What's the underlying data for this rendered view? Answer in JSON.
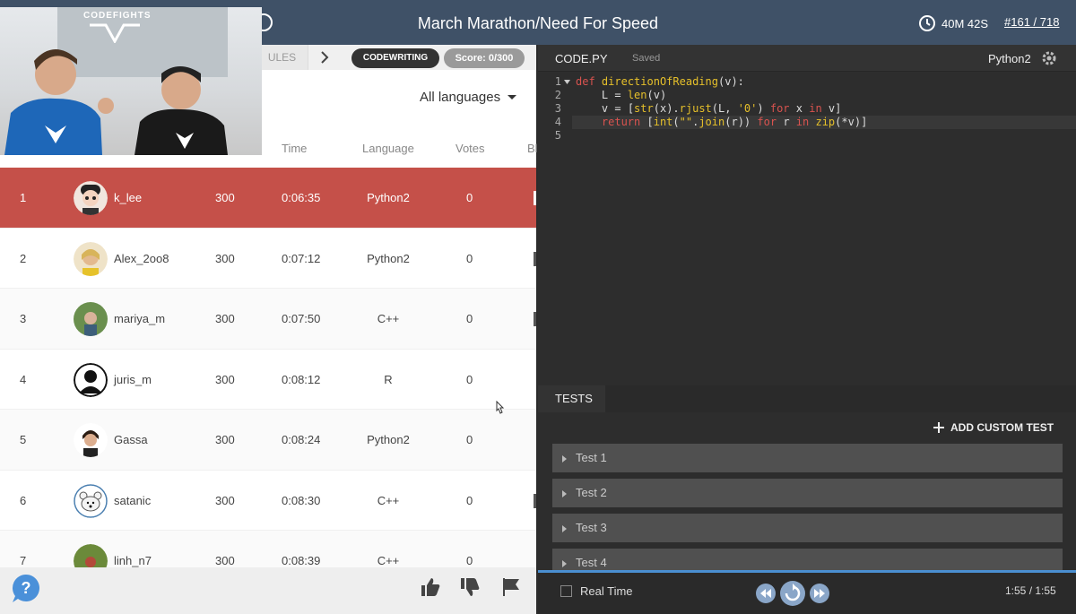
{
  "header": {
    "title": "March Marathon/Need For Speed",
    "timer": "40M 42S",
    "rank": "#161 / 718"
  },
  "left": {
    "tabs": {
      "rules": "ULES",
      "codewriting": "CODEWRITING",
      "score": "Score: 0/300"
    },
    "language_filter": "All languages",
    "columns": [
      "Time",
      "Language",
      "Votes",
      "Bl"
    ],
    "rows": [
      {
        "rank": "1",
        "user": "k_lee",
        "score": "300",
        "time": "0:06:35",
        "language": "Python2",
        "votes": "0"
      },
      {
        "rank": "2",
        "user": "Alex_2oo8",
        "score": "300",
        "time": "0:07:12",
        "language": "Python2",
        "votes": "0"
      },
      {
        "rank": "3",
        "user": "mariya_m",
        "score": "300",
        "time": "0:07:50",
        "language": "C++",
        "votes": "0"
      },
      {
        "rank": "4",
        "user": "juris_m",
        "score": "300",
        "time": "0:08:12",
        "language": "R",
        "votes": "0"
      },
      {
        "rank": "5",
        "user": "Gassa",
        "score": "300",
        "time": "0:08:24",
        "language": "Python2",
        "votes": "0"
      },
      {
        "rank": "6",
        "user": "satanic",
        "score": "300",
        "time": "0:08:30",
        "language": "C++",
        "votes": "0"
      },
      {
        "rank": "7",
        "user": "linh_n7",
        "score": "300",
        "time": "0:08:39",
        "language": "C++",
        "votes": "0"
      }
    ],
    "webcam_logo": "CODEFIGHTS"
  },
  "editor": {
    "filename": "CODE.PY",
    "status": "Saved",
    "language": "Python2",
    "lines": [
      {
        "no": "1",
        "text": "def directionOfReading(v):"
      },
      {
        "no": "2",
        "text": "    L = len(v)"
      },
      {
        "no": "3",
        "text": "    v = [str(x).rjust(L, '0') for x in v]"
      },
      {
        "no": "4",
        "text": "    return [int(\"\".join(r)) for r in zip(*v)]"
      },
      {
        "no": "5",
        "text": ""
      }
    ]
  },
  "tests": {
    "tab_label": "TESTS",
    "add_label": "ADD CUSTOM TEST",
    "items": [
      "Test 1",
      "Test 2",
      "Test 3",
      "Test 4"
    ]
  },
  "player": {
    "realtime_label": "Real Time",
    "time": "1:55 / 1:55"
  },
  "colors": {
    "topbar": "#3f5167",
    "highlight_row": "#c55049",
    "progress": "#4a8fd1"
  }
}
